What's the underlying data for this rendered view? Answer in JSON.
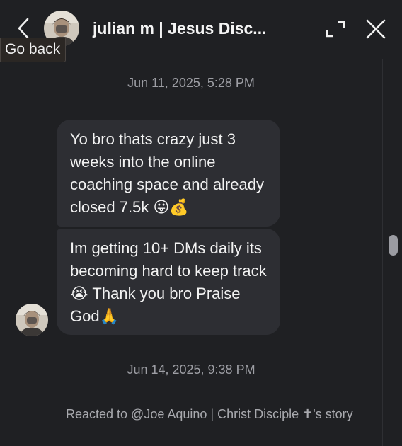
{
  "header": {
    "back_tooltip": "Go back",
    "title": "julian m | Jesus Disc...",
    "back_icon": "chevron-left-icon",
    "expand_icon": "expand-icon",
    "close_icon": "close-icon"
  },
  "conversation": {
    "timestamp_1": "Jun 11, 2025, 5:28 PM",
    "messages": [
      {
        "text": "Yo bro thats crazy just 3 weeks into the online coaching space and already closed 7.5k 😛💰"
      },
      {
        "text": "Im getting 10+ DMs daily its becoming hard to keep track😭 Thank you bro Praise God🙏"
      }
    ],
    "timestamp_2": "Jun 14, 2025, 9:38 PM",
    "reaction_text": "Reacted to @Joe Aquino | Christ Disciple ✝'s story"
  },
  "colors": {
    "background": "#1f2023",
    "bubble": "#2d2e33",
    "muted_text": "#9d9ea4"
  }
}
